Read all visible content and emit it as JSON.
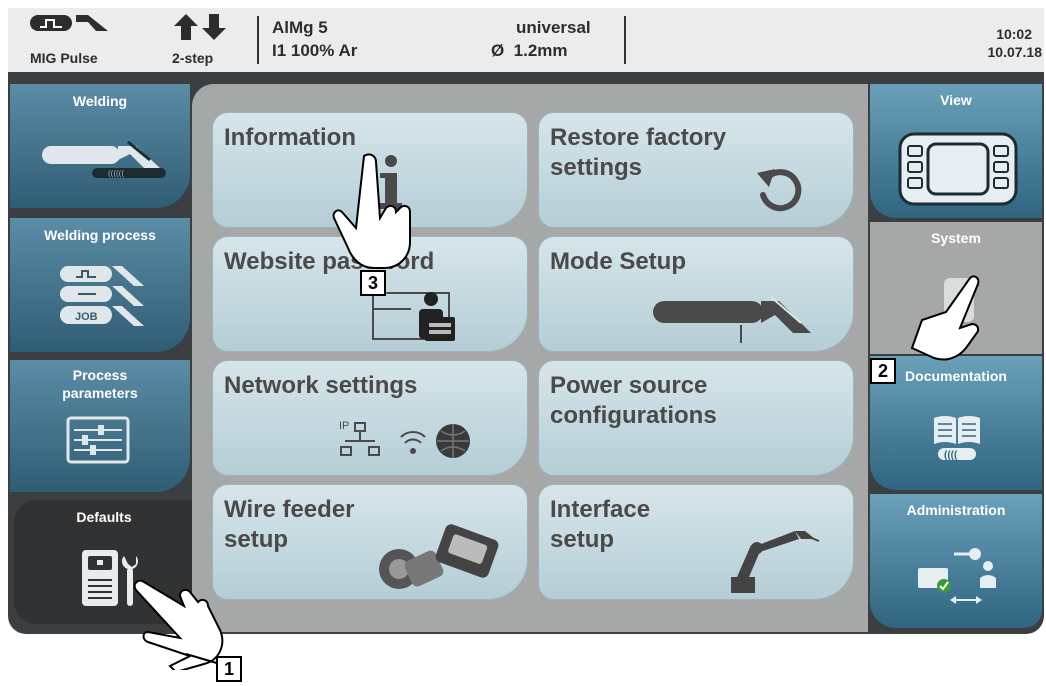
{
  "status_bar": {
    "process": "MIG Pulse",
    "mode": "2-step",
    "material": "AlMg 5",
    "gas": "I1 100% Ar",
    "characteristic": "universal",
    "wire_diameter": "Ø  1.2mm",
    "time": "10:02",
    "date": "10.07.18"
  },
  "left_nav": [
    {
      "label": "Welding"
    },
    {
      "label": "Welding process",
      "job_badge": "JOB"
    },
    {
      "label": "Process\nparameters"
    },
    {
      "label": "Defaults",
      "active": true
    }
  ],
  "tiles": [
    {
      "label": "Information"
    },
    {
      "label": "Restore factory\nsettings"
    },
    {
      "label": "Website password"
    },
    {
      "label": "Mode Setup"
    },
    {
      "label": "Network settings",
      "ip_label": "IP"
    },
    {
      "label": "Power source\nconfigurations"
    },
    {
      "label": "Wire feeder\nsetup"
    },
    {
      "label": "Interface\nsetup"
    }
  ],
  "right_nav": [
    {
      "label": "View"
    },
    {
      "label": "System",
      "active": true
    },
    {
      "label": "Documentation"
    },
    {
      "label": "Administration"
    }
  ],
  "callouts": [
    "1",
    "2",
    "3"
  ],
  "colors": {
    "nav_blue": "#4a7a93",
    "tile_bg": "#c6dbe2",
    "frame_dark": "#3c3f42",
    "panel_gray": "#a6a8a8"
  }
}
